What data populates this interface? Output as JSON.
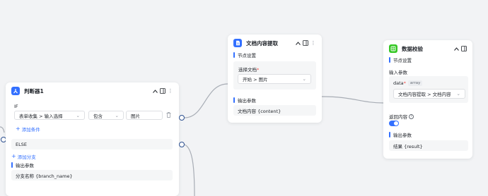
{
  "colors": {
    "canvas": "#f2f3f5",
    "accent": "#3370ff",
    "port_border": "#2b4f8f",
    "judge_icon": "#3370ff",
    "doc_icon": "#3370ff",
    "check_icon": "#34c724"
  },
  "judge_node": {
    "title": "判断器1",
    "icon": "branch-icon",
    "if_label": "IF",
    "condition": {
      "field": "表单收集 > 输入选择",
      "operator": "包含",
      "value": "图片"
    },
    "add_condition": "添加条件",
    "else_label": "ELSE",
    "add_branch": "添加分支",
    "output_section": "输出参数",
    "output_value": "分支名称 {branch_name}"
  },
  "doc_node": {
    "title": "文档内容提取",
    "icon": "document-icon",
    "settings_section": "节点设置",
    "select_label": "选择文档",
    "required_mark": "*",
    "select_value": "开始 > 图片",
    "output_section": "输出参数",
    "output_value": "文档内容 {content}"
  },
  "check_node": {
    "title": "数据校验",
    "icon": "data-check-icon",
    "settings_section": "节点设置",
    "input_label": "输入参数",
    "param_name": "data",
    "required_mark": "*",
    "param_type": "array",
    "param_value": "文档内容提取 > 文档内容",
    "return_label": "返回内容",
    "return_enabled": true,
    "output_section": "输出参数",
    "output_value": "结果 {result}"
  }
}
